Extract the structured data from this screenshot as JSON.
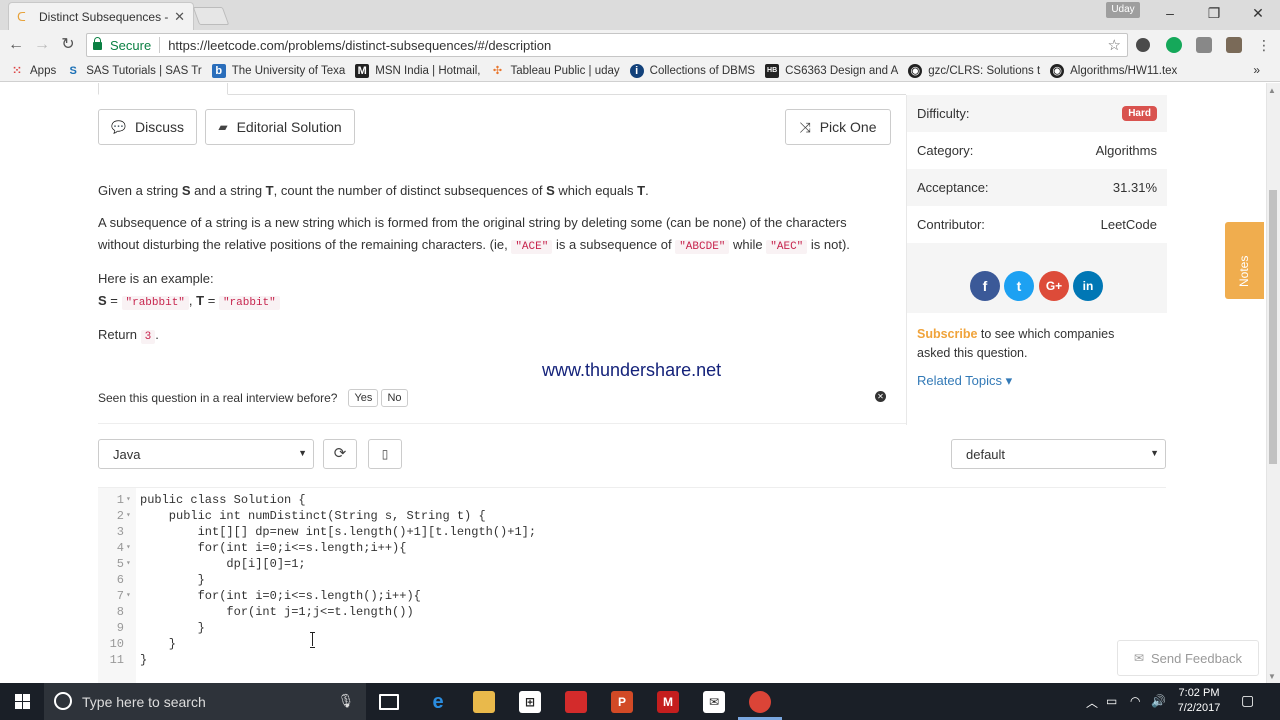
{
  "browser": {
    "tab_title": "Distinct Subsequences - ",
    "user_label": "Uday",
    "secure_label": "Secure",
    "url": "https://leetcode.com/problems/distinct-subsequences/#/description",
    "bookmarks": [
      {
        "icon": "apps-grid-icon",
        "label": "Apps"
      },
      {
        "icon": "sas-icon",
        "label": "SAS Tutorials | SAS Tr"
      },
      {
        "icon": "b-icon",
        "label": "The University of Texa"
      },
      {
        "icon": "msn-icon",
        "label": "MSN India | Hotmail,"
      },
      {
        "icon": "tableau-icon",
        "label": "Tableau Public | uday"
      },
      {
        "icon": "info-icon",
        "label": "Collections of DBMS"
      },
      {
        "icon": "hb-icon",
        "label": "CS6363 Design and A"
      },
      {
        "icon": "github-icon",
        "label": "gzc/CLRS: Solutions t"
      },
      {
        "icon": "github-icon",
        "label": "Algorithms/HW11.tex"
      }
    ],
    "bookmarks_more": "»"
  },
  "buttons": {
    "discuss": "Discuss",
    "editorial": "Editorial Solution",
    "pick_one": "Pick One"
  },
  "description": {
    "p1_a": "Given a string ",
    "p1_s": "S",
    "p1_b": " and a string ",
    "p1_t": "T",
    "p1_c": ", count the number of distinct subsequences of ",
    "p1_s2": "S",
    "p1_d": " which equals ",
    "p1_t2": "T",
    "p1_e": ".",
    "p2_a": "A subsequence of a string is a new string which is formed from the original string by deleting some (can be none) of the characters without disturbing the relative positions of the remaining characters. (ie, ",
    "p2_code1": "\"ACE\"",
    "p2_b": " is a subsequence of ",
    "p2_code2": "\"ABCDE\"",
    "p2_c": " while ",
    "p2_code3": "\"AEC\"",
    "p2_d": " is not).",
    "example_label": "Here is an example:",
    "ex_s": "S",
    "ex_eq1": " = ",
    "ex_sval": "\"rabbbit\"",
    "ex_comma": ", ",
    "ex_t": "T",
    "ex_eq2": " = ",
    "ex_tval": "\"rabbit\"",
    "return_label": "Return ",
    "return_val": "3",
    "return_end": "."
  },
  "watermark": "www.thundershare.net",
  "interview": {
    "question": "Seen this question in a real interview before?",
    "yes": "Yes",
    "no": "No"
  },
  "sidebar": {
    "difficulty_label": "Difficulty:",
    "difficulty_value": "Hard",
    "category_label": "Category:",
    "category_value": "Algorithms",
    "acceptance_label": "Acceptance:",
    "acceptance_value": "31.31%",
    "contributor_label": "Contributor:",
    "contributor_value": "LeetCode",
    "social": [
      {
        "icon": "facebook-icon",
        "glyph": "f",
        "color": "#3b5998"
      },
      {
        "icon": "twitter-icon",
        "glyph": "t",
        "color": "#1da1f2"
      },
      {
        "icon": "google-plus-icon",
        "glyph": "G+",
        "color": "#dd4b39"
      },
      {
        "icon": "linkedin-icon",
        "glyph": "in",
        "color": "#0077b5"
      }
    ],
    "subscribe_link": "Subscribe",
    "subscribe_text": " to see which companies asked this question.",
    "related_topics": "Related Topics ▾"
  },
  "notes_label": "Notes",
  "editor": {
    "language": "Java",
    "theme": "default",
    "lines": [
      {
        "n": "1",
        "fold": "▾",
        "code": "public class Solution {"
      },
      {
        "n": "2",
        "fold": "▾",
        "code": "    public int numDistinct(String s, String t) {"
      },
      {
        "n": "3",
        "fold": "",
        "code": "        int[][] dp=new int[s.length()+1][t.length()+1];"
      },
      {
        "n": "4",
        "fold": "▾",
        "code": "        for(int i=0;i<=s.length;i++){"
      },
      {
        "n": "5",
        "fold": "▾",
        "code": "            dp[i][0]=1;"
      },
      {
        "n": "6",
        "fold": "",
        "code": "        }"
      },
      {
        "n": "7",
        "fold": "▾",
        "code": "        for(int i=0;i<=s.length();i++){"
      },
      {
        "n": "8",
        "fold": "",
        "code": "            for(int j=1;j<=t.length())"
      },
      {
        "n": "9",
        "fold": "",
        "code": "        }"
      },
      {
        "n": "10",
        "fold": "",
        "code": "    }"
      },
      {
        "n": "11",
        "fold": "",
        "code": "}"
      }
    ]
  },
  "feedback": "Send Feedback",
  "taskbar": {
    "search_placeholder": "Type here to search",
    "time": "7:02 PM",
    "date": "7/2/2017"
  },
  "colors": {
    "hard_badge": "#d9534f",
    "subscribe": "#f0a33a",
    "link": "#337ab7",
    "notes": "#f0ad4e",
    "watermark": "#14227a"
  }
}
